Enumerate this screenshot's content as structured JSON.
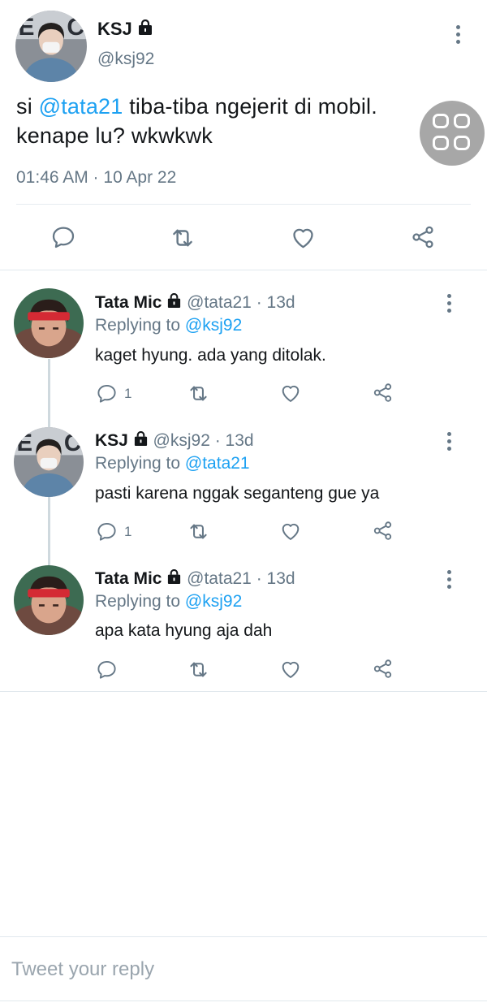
{
  "main_tweet": {
    "name": "KSJ",
    "handle": "@ksj92",
    "text_before": "si ",
    "mention": "@tata21",
    "text_after": " tiba-tiba ngejerit di mobil. kenape lu? wkwkwk",
    "timestamp": "01:46 AM · 10 Apr 22"
  },
  "replies": [
    {
      "name": "Tata Mic",
      "handle": "@tata21",
      "time": "· 13d",
      "replying_label": "Replying to",
      "replying_to": "@ksj92",
      "text": "kaget hyung. ada yang ditolak.",
      "reply_count": "1"
    },
    {
      "name": "KSJ",
      "handle": "@ksj92",
      "time": "· 13d",
      "replying_label": "Replying to",
      "replying_to": "@tata21",
      "text": "pasti karena nggak seganteng gue ya",
      "reply_count": "1"
    },
    {
      "name": "Tata Mic",
      "handle": "@tata21",
      "time": "· 13d",
      "replying_label": "Replying to",
      "replying_to": "@ksj92",
      "text": "apa kata hyung aja dah",
      "reply_count": ""
    }
  ],
  "composer": {
    "placeholder": "Tweet your reply"
  },
  "icons": {
    "reply": "reply-icon",
    "retweet": "retweet-icon",
    "like": "heart-icon",
    "share": "share-icon",
    "lock": "lock-icon",
    "more": "more-vertical-icon",
    "floating": "grid-icon"
  },
  "colors": {
    "accent": "#1da1f2",
    "secondary_text": "#657786",
    "divider": "#e6ecf0"
  }
}
